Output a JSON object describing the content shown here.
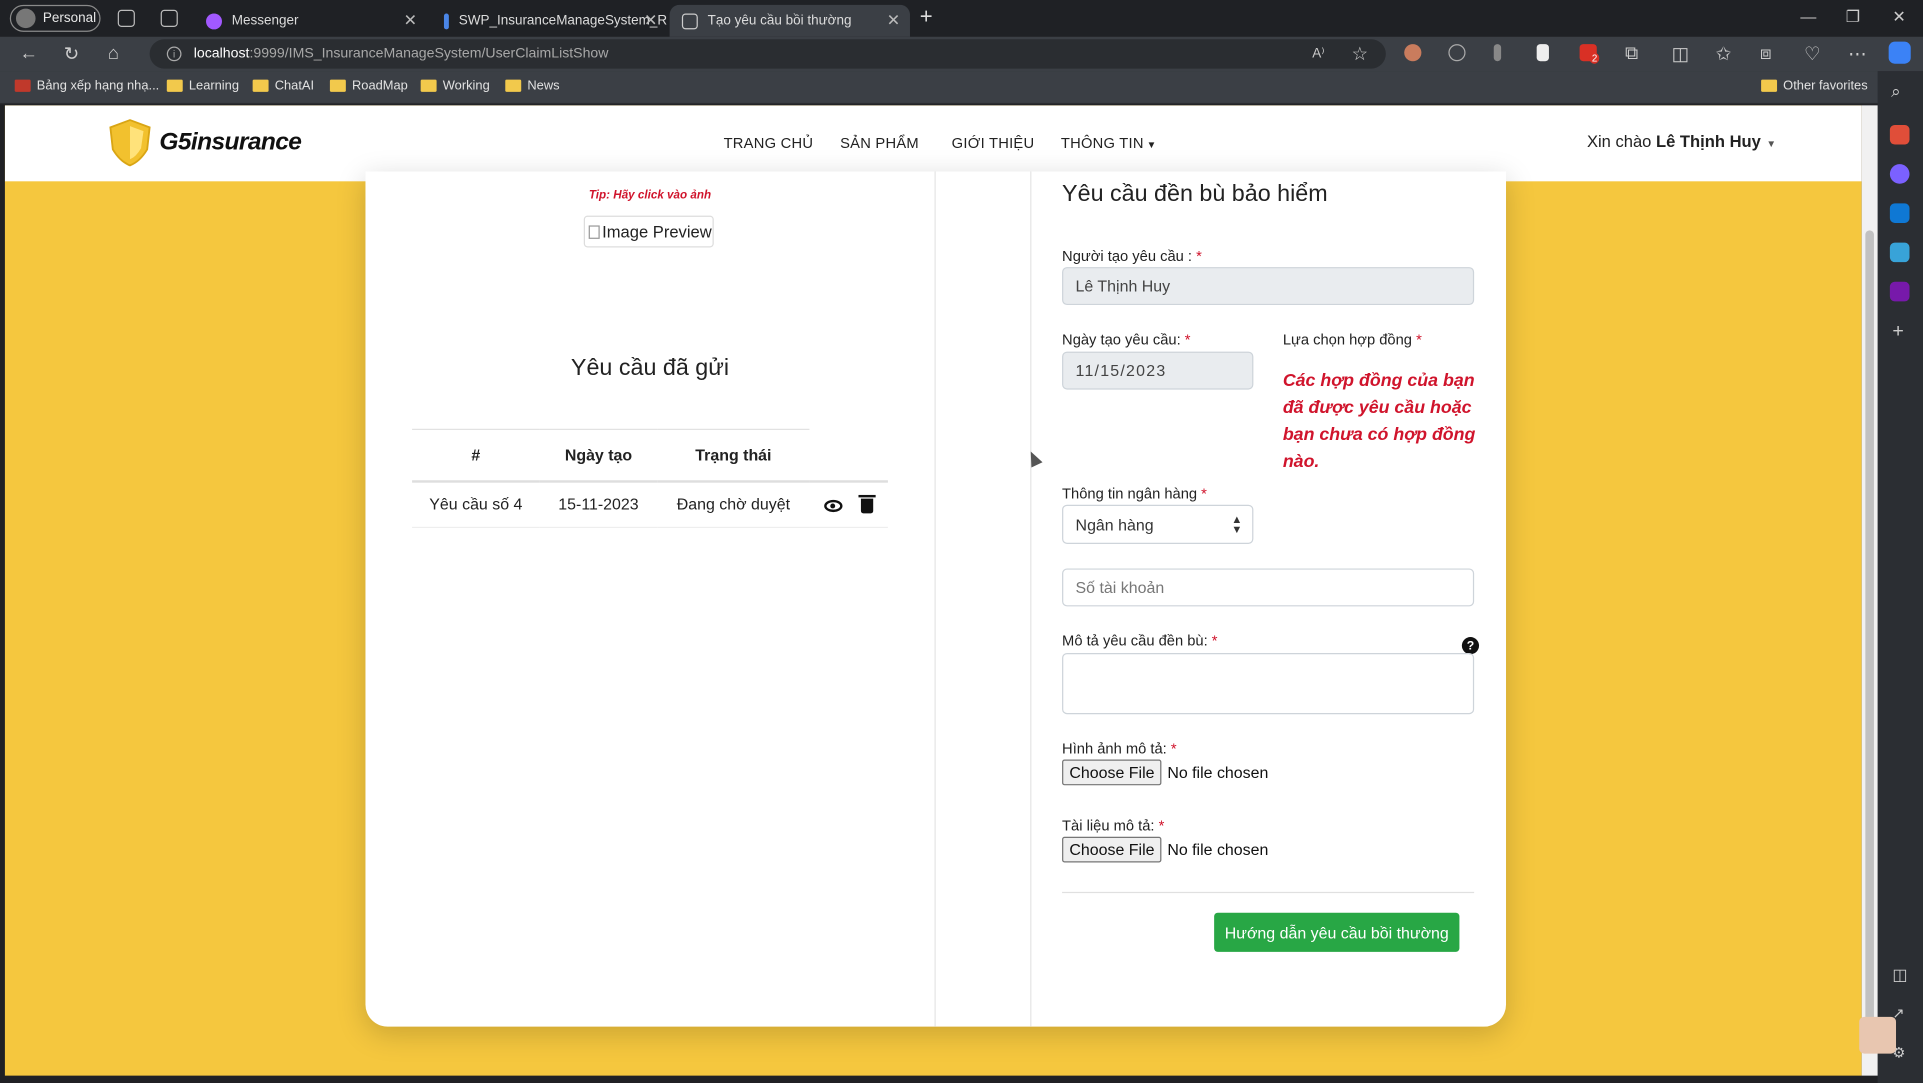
{
  "browser": {
    "profile": "Personal",
    "tabs": [
      {
        "label": "Messenger"
      },
      {
        "label": "SWP_InsuranceManageSystem_R"
      },
      {
        "label": "Tạo yêu cầu bồi thường"
      }
    ],
    "url_host": "localhost",
    "url_rest": ":9999/IMS_InsuranceManageSystem/UserClaimListShow",
    "bookmarks": [
      "Bảng xếp hạng nhạ...",
      "Learning",
      "ChatAI",
      "RoadMap",
      "Working",
      "News"
    ],
    "other_favorites": "Other favorites",
    "extension_badge": "2"
  },
  "site": {
    "logo": "G5insurance",
    "nav": [
      "TRANG CHỦ",
      "SẢN PHẨM",
      "GIỚI THIỆU",
      "THÔNG TIN"
    ],
    "greeting_prefix": "Xin chào ",
    "user_name": "Lê Thịnh Huy"
  },
  "left": {
    "tip": "Tip: Hãy click vào ảnh",
    "image_alt": "Image Preview",
    "title": "Yêu cầu đã gửi",
    "columns": [
      "#",
      "Ngày tạo",
      "Trạng thái"
    ],
    "rows": [
      {
        "name": "Yêu cầu số 4",
        "date": "15-11-2023",
        "status": "Đang chờ duyệt"
      }
    ]
  },
  "form": {
    "title": "Yêu cầu đền bù bảo hiểm",
    "creator_label": "Người tạo yêu cầu :",
    "creator_value": "Lê Thịnh Huy",
    "date_label": "Ngày tạo yêu cầu:",
    "date_value": "11/15/2023",
    "contract_label": "Lựa chọn hợp đồng",
    "contract_message": "Các hợp đồng của bạn đã được yêu cầu hoặc bạn chưa có hợp đồng nào.",
    "bank_label": "Thông tin ngân hàng",
    "bank_select": "Ngân hàng",
    "account_placeholder": "Số tài khoản",
    "desc_label": "Mô tả yêu cầu đền bù:",
    "help": "?",
    "image_label": "Hình ảnh mô tả:",
    "doc_label": "Tài liệu mô tả:",
    "choose_file": "Choose File",
    "no_file": "No file chosen",
    "submit": "Hướng dẫn yêu cầu bồi thường",
    "required_mark": "*"
  }
}
